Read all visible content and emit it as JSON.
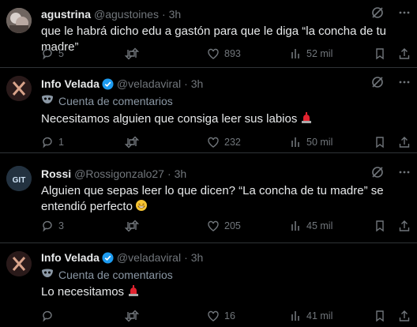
{
  "tweets": [
    {
      "name": "agustrina",
      "handle": "@agustoines",
      "dot": "·",
      "time": "3h",
      "verified": false,
      "subline": "",
      "text": "que le habrá dicho edu a gastón para que le diga “la concha de tu madre”",
      "replies": "5",
      "retweets": "",
      "likes": "893",
      "views": "52 mil"
    },
    {
      "name": "Info Velada",
      "handle": "@veladaviral",
      "dot": "·",
      "time": "3h",
      "verified": true,
      "subline": "Cuenta de comentarios",
      "text": "Necesitamos alguien que consiga leer sus labios",
      "replies": "1",
      "retweets": "",
      "likes": "232",
      "views": "50 mil"
    },
    {
      "name": "Rossi",
      "handle": "@Rossigonzalo27",
      "dot": "·",
      "time": "3h",
      "verified": false,
      "subline": "",
      "text": "Alguien que sepas leer lo que dicen? “La concha de tu madre” se entendió perfecto",
      "replies": "3",
      "retweets": "",
      "likes": "205",
      "views": "45 mil"
    },
    {
      "name": "Info Velada",
      "handle": "@veladaviral",
      "dot": "·",
      "time": "3h",
      "verified": true,
      "subline": "Cuenta de comentarios",
      "text": "Lo necesitamos",
      "replies": "",
      "retweets": "",
      "likes": "16",
      "views": "41 mil"
    }
  ],
  "colors": {
    "background": "#000000",
    "text": "#e7e9ea",
    "muted": "#71767b",
    "verified": "#1d9bf0",
    "divider": "#2f3336"
  },
  "icons": [
    "grok-icon",
    "more-icon",
    "reply-icon",
    "retweet-icon",
    "like-icon",
    "views-icon",
    "bookmark-icon",
    "share-icon",
    "verified-badge-icon",
    "siren-emoji",
    "grin-emoji",
    "mask-icon"
  ]
}
